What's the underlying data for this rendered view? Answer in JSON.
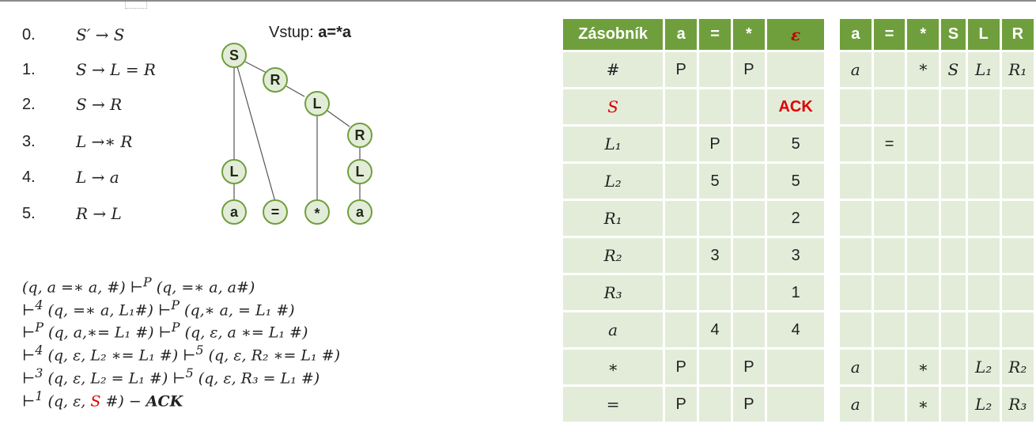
{
  "grammar": {
    "rules": [
      {
        "num": "0.",
        "text": "S′ → S"
      },
      {
        "num": "1.",
        "text": "S → L = R"
      },
      {
        "num": "2.",
        "text": "S → R"
      },
      {
        "num": "3.",
        "text": "L →∗ R"
      },
      {
        "num": "4.",
        "text": "L → a"
      },
      {
        "num": "5.",
        "text": "R → L"
      }
    ]
  },
  "input": {
    "label": "Vstup:",
    "value": "a=*a"
  },
  "tree": {
    "nodes": [
      "S",
      "R",
      "L",
      "R",
      "L",
      "L",
      "a",
      "=",
      "*",
      "a"
    ],
    "colors": {
      "fill": "#e3ecd9",
      "stroke": "#6f9f3c"
    }
  },
  "derivation": {
    "lines": [
      [
        "(q, a =∗ a, #) ⊢",
        "P",
        " (q, =∗ a, a#)"
      ],
      [
        "⊢",
        "4",
        " (q, =∗ a, L₁#) ⊢",
        "P",
        " (q,∗ a, = L₁ #)"
      ],
      [
        "⊢",
        "P",
        " (q, a,∗= L₁ #) ⊢",
        "P",
        " (q, ε, a ∗= L₁ #)"
      ],
      [
        "⊢",
        "4",
        " (q, ε, L₂ ∗= L₁ #) ⊢",
        "5",
        " (q, ε, R₂ ∗= L₁ #)"
      ],
      [
        "⊢",
        "3",
        " (q, ε, L₂ = L₁ #) ⊢",
        "5",
        " (q, ε, R₃ = L₁ #)"
      ]
    ],
    "last": {
      "prefix": "⊢",
      "sup": "1",
      "open": " (q, ε, ",
      "red": "S",
      "close": " #)  − ",
      "ack": "ACK"
    }
  },
  "table": {
    "headers": [
      "Zásobník",
      "a",
      "=",
      "*",
      "ε",
      "a",
      "=",
      "*",
      "S",
      "L",
      "R"
    ],
    "rows": [
      {
        "stack": "#",
        "action": [
          "P",
          "",
          "P",
          ""
        ],
        "goto": [
          "a",
          "",
          "*",
          "S",
          "L₁",
          "R₁"
        ]
      },
      {
        "stack": "S",
        "action": [
          "",
          "",
          "",
          "ACK"
        ],
        "goto": [
          "",
          "",
          "",
          "",
          "",
          ""
        ]
      },
      {
        "stack": "L₁",
        "action": [
          "",
          "P",
          "",
          "5"
        ],
        "goto": [
          "",
          "=",
          "",
          "",
          "",
          ""
        ]
      },
      {
        "stack": "L₂",
        "action": [
          "",
          "5",
          "",
          "5"
        ],
        "goto": [
          "",
          "",
          "",
          "",
          "",
          ""
        ]
      },
      {
        "stack": "R₁",
        "action": [
          "",
          "",
          "",
          "2"
        ],
        "goto": [
          "",
          "",
          "",
          "",
          "",
          ""
        ]
      },
      {
        "stack": "R₂",
        "action": [
          "",
          "3",
          "",
          "3"
        ],
        "goto": [
          "",
          "",
          "",
          "",
          "",
          ""
        ]
      },
      {
        "stack": "R₃",
        "action": [
          "",
          "",
          "",
          "1"
        ],
        "goto": [
          "",
          "",
          "",
          "",
          "",
          ""
        ]
      },
      {
        "stack": "a",
        "action": [
          "",
          "4",
          "",
          "4"
        ],
        "goto": [
          "",
          "",
          "",
          "",
          "",
          ""
        ]
      },
      {
        "stack": "∗",
        "action": [
          "P",
          "",
          "P",
          ""
        ],
        "goto": [
          "a",
          "",
          "∗",
          "",
          "L₂",
          "R₂"
        ]
      },
      {
        "stack": "=",
        "action": [
          "P",
          "",
          "P",
          ""
        ],
        "goto": [
          "a",
          "",
          "∗",
          "",
          "L₂",
          "R₃"
        ]
      }
    ],
    "colors": {
      "header": "#6f9f3c",
      "cell": "#e3ecd9",
      "accent": "#e00000"
    }
  }
}
